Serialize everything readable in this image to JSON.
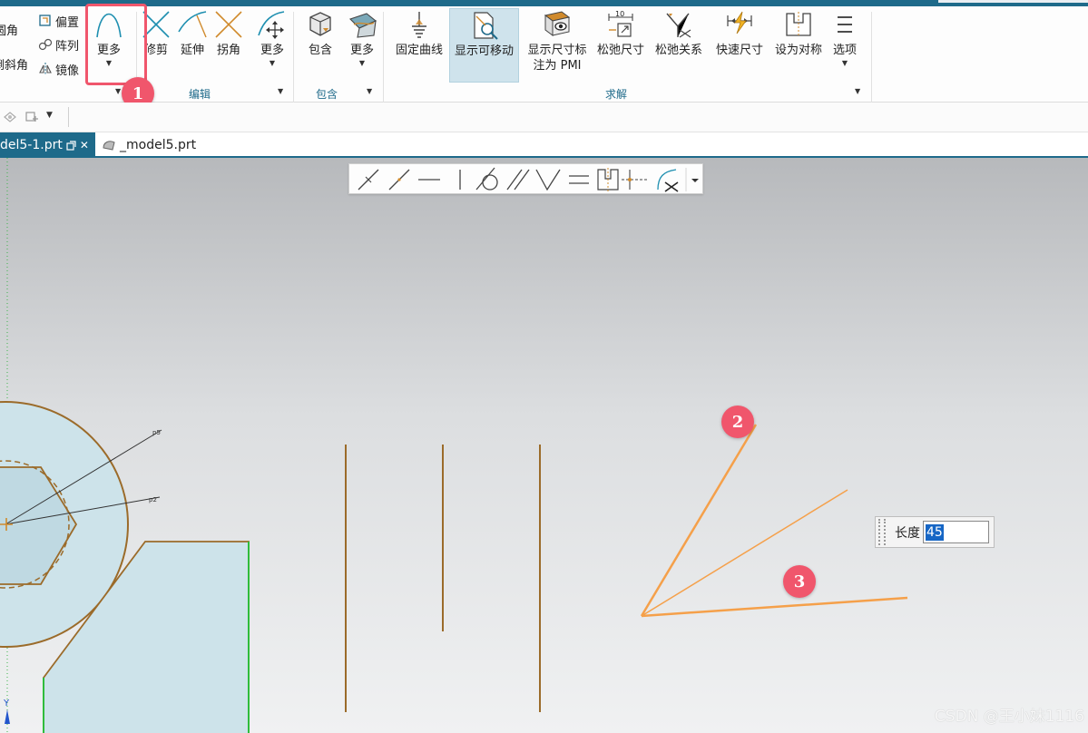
{
  "ribbon": {
    "small_left": [
      "圆角",
      "倒斜角"
    ],
    "small_mid": [
      "偏置",
      "阵列",
      "镜像"
    ],
    "curve_more": "更多",
    "edit": {
      "trim": "修剪",
      "extend": "延伸",
      "corner": "拐角",
      "more": "更多",
      "group_label": "编辑"
    },
    "include": {
      "include": "包含",
      "more": "更多",
      "group_label": "包含"
    },
    "solve": {
      "fix_curve": "固定曲线",
      "show_movable": "显示可移动",
      "show_dim_line1": "显示尺寸标",
      "show_dim_line2": "注为 PMI",
      "relax_dim": "松弛尺寸",
      "relax_rel": "松弛关系",
      "quick_dim": "快速尺寸",
      "set_symmetric": "设为对称",
      "options": "选项",
      "group_label": "求解",
      "dim_icon_value": "10"
    }
  },
  "tabs": {
    "active": "del5-1.prt",
    "inactive": "_model5.prt"
  },
  "canvas": {
    "length_label": "长度",
    "length_value": "45",
    "dim_labels": [
      "p5",
      "p2"
    ]
  },
  "markers": [
    "1",
    "2",
    "3"
  ],
  "watermark": "CSDN @王小妹1116",
  "colors": {
    "accent": "#1e6a8a",
    "marker": "#f0566c",
    "sketch_curve": "#9b6b2a",
    "selected_line": "#f5a04a",
    "fill": "#cde3ea",
    "green_edge": "#22c23a"
  }
}
